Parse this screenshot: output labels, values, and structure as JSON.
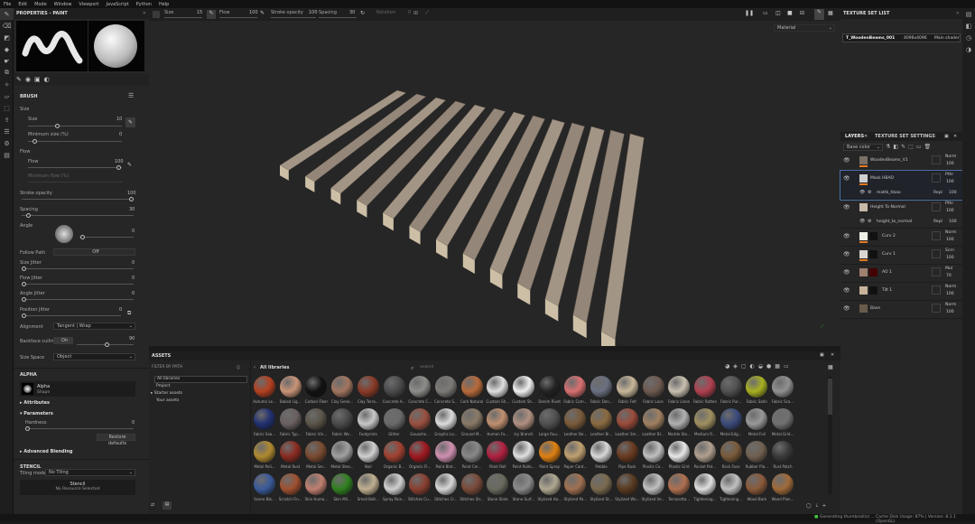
{
  "menu": [
    "File",
    "Edit",
    "Mode",
    "Window",
    "Viewport",
    "JavaScript",
    "Python",
    "Help"
  ],
  "toolbar": {
    "size_label": "Size",
    "size_value": "15",
    "flow_label": "Flow",
    "flow_value": "100",
    "stroke_opacity_label": "Stroke opacity",
    "stroke_opacity_value": "100",
    "spacing_label": "Spacing",
    "spacing_value": "30",
    "angle_label": "Rotation",
    "angle_value": "0",
    "material_select": "Material"
  },
  "properties": {
    "title": "PROPERTIES - PAINT",
    "brush_header": "BRUSH",
    "size_label": "Size",
    "size_value": "10",
    "min_size_label": "Minimum size (%)",
    "min_size_value": "0",
    "flow_label": "Flow",
    "flow_sub": "Flow",
    "flow_value": "100",
    "min_flow_label": "Minimum flow (%)",
    "stroke_opacity_label": "Stroke opacity",
    "stroke_opacity_value": "100",
    "spacing_label": "Spacing",
    "spacing_value": "30",
    "angle_label": "Angle",
    "angle_value": "0",
    "follow_path_label": "Follow Path",
    "follow_path_value": "Off",
    "size_jitter_label": "Size Jitter",
    "size_jitter_value": "0",
    "flow_jitter_label": "Flow Jitter",
    "flow_jitter_value": "0",
    "angle_jitter_label": "Angle Jitter",
    "angle_jitter_value": "0",
    "position_jitter_label": "Position Jitter",
    "position_jitter_value": "0",
    "alignment_label": "Alignment",
    "alignment_value": "Tangent | Wrap",
    "backface_label": "Backface culling",
    "backface_value": "On",
    "backface_num": "90",
    "size_space_label": "Size Space",
    "size_space_value": "Object",
    "alpha_header": "ALPHA",
    "alpha_name": "Alpha",
    "alpha_sub": "Shape",
    "attributes_label": "Attributes",
    "parameters_label": "Parameters",
    "hardness_label": "Hardness",
    "hardness_value": "0",
    "restore_label": "Restore defaults",
    "adv_blending_label": "Advanced Blending",
    "stencil_header": "STENCIL",
    "tiling_label": "Tiling mode",
    "tiling_value": "No Tiling",
    "stencil_name": "Stencil",
    "stencil_sub": "No Resource Selected"
  },
  "texture_set_list": {
    "title": "TEXTURE SET LIST",
    "item_name": "T_WoodenBeams_001",
    "item_res": "4096x4096",
    "item_shader": "Main shader"
  },
  "layers": {
    "tab_layers": "LAYERS",
    "tab_settings": "TEXTURE SET SETTINGS",
    "channel_select": "Base color",
    "items": [
      {
        "name": "WoodenBeams_V1",
        "blend": "Norm",
        "opacity": "100"
      },
      {
        "name": "Mask HBAO",
        "blend": "Pthr",
        "opacity": "100",
        "sub_name": "mattk_hbao",
        "sub_blend": "Repl",
        "sub_opacity": "100"
      },
      {
        "name": "Height To Normal",
        "blend": "Pthr",
        "opacity": "100",
        "sub_name": "height_to_normal",
        "sub_blend": "Repl",
        "sub_opacity": "100"
      },
      {
        "name": "Curv 2",
        "blend": "Norm",
        "opacity": "100"
      },
      {
        "name": "Curv 1",
        "blend": "Scrn",
        "opacity": "100"
      },
      {
        "name": "AO 1",
        "blend": "Mul",
        "opacity": "70"
      },
      {
        "name": "Tilt 1",
        "blend": "Norm",
        "opacity": "100"
      },
      {
        "name": "Base",
        "blend": "Norm",
        "opacity": "100"
      }
    ]
  },
  "assets": {
    "title": "ASSETS",
    "filter_label": "FILTER BY PATH",
    "all_libraries": "All libraries",
    "tree": [
      "All libraries",
      "Project",
      "Starter assets",
      "Your assets"
    ],
    "search_placeholder": "Search",
    "rows": [
      [
        "Autumn Le...",
        "Baked Lig...",
        "Carbon Fiber",
        "Clay Gene...",
        "Clay Terra...",
        "Concrete A...",
        "Concrete C...",
        "Concrete S...",
        "Cork Natural",
        "Custom Sh...",
        "Custom Sh...",
        "Denim Rivet",
        "Fabric Com...",
        "Fabric Den...",
        "Fabric Felt",
        "Fabric Lace",
        "Fabric Linen",
        "Fabric Rotten",
        "Fabric Pur...",
        "Fabric Satin",
        "Fabric Sca..."
      ],
      [
        "Fabric Sea...",
        "Fabric Typ...",
        "Fabric Vin...",
        "Fabric Wo...",
        "Footprints",
        "Glitter",
        "Gouache...",
        "Graphic Lo...",
        "Ground M...",
        "Human Fa...",
        "Icy Branch",
        "Large Ruu...",
        "Leather Be...",
        "Leather Br...",
        "Leather Sm...",
        "Leather Bl...",
        "Marble Sto...",
        "Medium R...",
        "Metal Edg...",
        "Metal Foil",
        "Metal Grid..."
      ],
      [
        "Metal Poli...",
        "Metal Rust",
        "Metal Ser...",
        "Metal Stee...",
        "Nail",
        "Organic B...",
        "Organic Fl...",
        "Paint Blot...",
        "Paint Cer...",
        "Paint Roll",
        "Paint Rolle...",
        "Paint Spray",
        "Paper Card...",
        "Pebble",
        "Pipe Rack",
        "Plastic Ce...",
        "Plastic Grid",
        "Pocket Pat...",
        "Rock Face",
        "Rubber Pla...",
        "Rust Patch"
      ],
      [
        "Scene Blo...",
        "Scratch Fin...",
        "Skin Huma...",
        "Skin Mil...",
        "Small Bolt...",
        "Spray Pain...",
        "Stitches Cu...",
        "Stitches Cr...",
        "Stitches Str...",
        "Stone Slate",
        "Stone Surf...",
        "Stylized Ha...",
        "Stylized Pa...",
        "Stylized St...",
        "Stylized Wo...",
        "Stylized Ve...",
        "Terracotta...",
        "Tightening...",
        "Tightening...",
        "Wood Bark",
        "Wood Plan..."
      ]
    ]
  },
  "status": {
    "left": "Generating thumbnail(s) ...",
    "cache": "Cache Disk Usage:",
    "pct": "87%",
    "version": "Version: 8.1.1 (OpenGL)"
  }
}
